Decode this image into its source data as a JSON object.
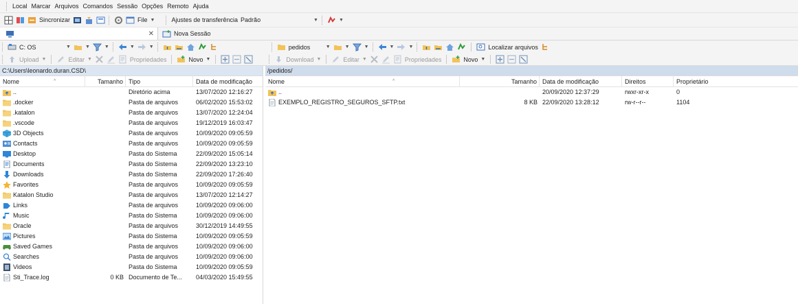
{
  "menu": [
    "Local",
    "Marcar",
    "Arquivos",
    "Comandos",
    "Sessão",
    "Opções",
    "Remoto",
    "Ajuda"
  ],
  "toolbar": {
    "sync_label": "Sincronizar",
    "file_label": "File",
    "transfer_settings_label": "Ajustes de transferência",
    "transfer_settings_value": "Padrão"
  },
  "tabs": {
    "new_session_label": "Nova Sessão"
  },
  "left_nav": {
    "drive_label": "C: OS"
  },
  "right_nav": {
    "folder_label": "pedidos",
    "find_files_label": "Localizar arquivos"
  },
  "left_actions": {
    "upload": "Upload",
    "edit": "Editar",
    "properties": "Propriedades",
    "new": "Novo"
  },
  "right_actions": {
    "download": "Download",
    "edit": "Editar",
    "properties": "Propriedades",
    "new": "Novo"
  },
  "left_pane": {
    "path": "C:\\Users\\leonardo.duran.CSD\\",
    "columns": {
      "name": "Nome",
      "size": "Tamanho",
      "type": "Tipo",
      "modified": "Data de modificação"
    },
    "rows": [
      {
        "icon": "up",
        "name": "..",
        "size": "",
        "type": "Diretório acima",
        "modified": "13/07/2020 12:16:27"
      },
      {
        "icon": "folder",
        "name": ".docker",
        "size": "",
        "type": "Pasta de arquivos",
        "modified": "06/02/2020 15:53:02"
      },
      {
        "icon": "folder",
        "name": ".katalon",
        "size": "",
        "type": "Pasta de arquivos",
        "modified": "13/07/2020 12:24:04"
      },
      {
        "icon": "folder",
        "name": ".vscode",
        "size": "",
        "type": "Pasta de arquivos",
        "modified": "19/12/2019 16:03:47"
      },
      {
        "icon": "objects3d",
        "name": "3D Objects",
        "size": "",
        "type": "Pasta de arquivos",
        "modified": "10/09/2020 09:05:59"
      },
      {
        "icon": "contacts",
        "name": "Contacts",
        "size": "",
        "type": "Pasta de arquivos",
        "modified": "10/09/2020 09:05:59"
      },
      {
        "icon": "desktop",
        "name": "Desktop",
        "size": "",
        "type": "Pasta do Sistema",
        "modified": "22/09/2020 15:05:14"
      },
      {
        "icon": "documents",
        "name": "Documents",
        "size": "",
        "type": "Pasta do Sistema",
        "modified": "22/09/2020 13:23:10"
      },
      {
        "icon": "downloads",
        "name": "Downloads",
        "size": "",
        "type": "Pasta do Sistema",
        "modified": "22/09/2020 17:26:40"
      },
      {
        "icon": "favorites",
        "name": "Favorites",
        "size": "",
        "type": "Pasta de arquivos",
        "modified": "10/09/2020 09:05:59"
      },
      {
        "icon": "folder",
        "name": "Katalon Studio",
        "size": "",
        "type": "Pasta de arquivos",
        "modified": "13/07/2020 12:14:27"
      },
      {
        "icon": "links",
        "name": "Links",
        "size": "",
        "type": "Pasta de arquivos",
        "modified": "10/09/2020 09:06:00"
      },
      {
        "icon": "music",
        "name": "Music",
        "size": "",
        "type": "Pasta do Sistema",
        "modified": "10/09/2020 09:06:00"
      },
      {
        "icon": "folder",
        "name": "Oracle",
        "size": "",
        "type": "Pasta de arquivos",
        "modified": "30/12/2019 14:49:55"
      },
      {
        "icon": "pictures",
        "name": "Pictures",
        "size": "",
        "type": "Pasta do Sistema",
        "modified": "10/09/2020 09:05:59"
      },
      {
        "icon": "savedgames",
        "name": "Saved Games",
        "size": "",
        "type": "Pasta de arquivos",
        "modified": "10/09/2020 09:06:00"
      },
      {
        "icon": "searches",
        "name": "Searches",
        "size": "",
        "type": "Pasta de arquivos",
        "modified": "10/09/2020 09:06:00"
      },
      {
        "icon": "videos",
        "name": "Videos",
        "size": "",
        "type": "Pasta do Sistema",
        "modified": "10/09/2020 09:05:59"
      },
      {
        "icon": "file",
        "name": "Sti_Trace.log",
        "size": "0 KB",
        "type": "Documento de Te...",
        "modified": "04/03/2020 15:49:55"
      }
    ]
  },
  "right_pane": {
    "path": "/pedidos/",
    "columns": {
      "name": "Nome",
      "size": "Tamanho",
      "modified": "Data de modificação",
      "rights": "Direitos",
      "owner": "Proprietário"
    },
    "rows": [
      {
        "icon": "up",
        "name": "..",
        "size": "",
        "modified": "20/09/2020 12:37:29",
        "rights": "rwxr-xr-x",
        "owner": "0"
      },
      {
        "icon": "file",
        "name": "EXEMPLO_REGISTRO_SEGUROS_SFTP.txt",
        "size": "8 KB",
        "modified": "22/09/2020 13:28:12",
        "rights": "rw-r--r--",
        "owner": "1104"
      }
    ]
  },
  "colors": {
    "accent_path_left": "#dce6f3",
    "accent_path_right": "#cfdcec",
    "folder": "#f2c35b"
  }
}
